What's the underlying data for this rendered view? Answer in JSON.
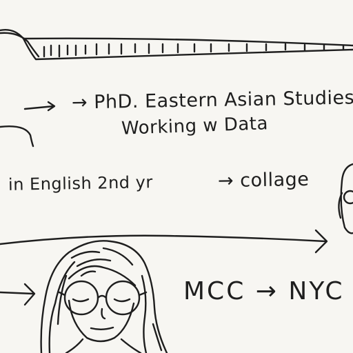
{
  "notes": {
    "phd": "→ PhD. Eastern Asian Studies",
    "data": "Working w Data",
    "english": "in English 2nd yr",
    "collage": "→ collage",
    "mcc": "MCC → NYC"
  },
  "colors": {
    "paper": "#f7f6f2",
    "ink": "#1e1e1e"
  }
}
